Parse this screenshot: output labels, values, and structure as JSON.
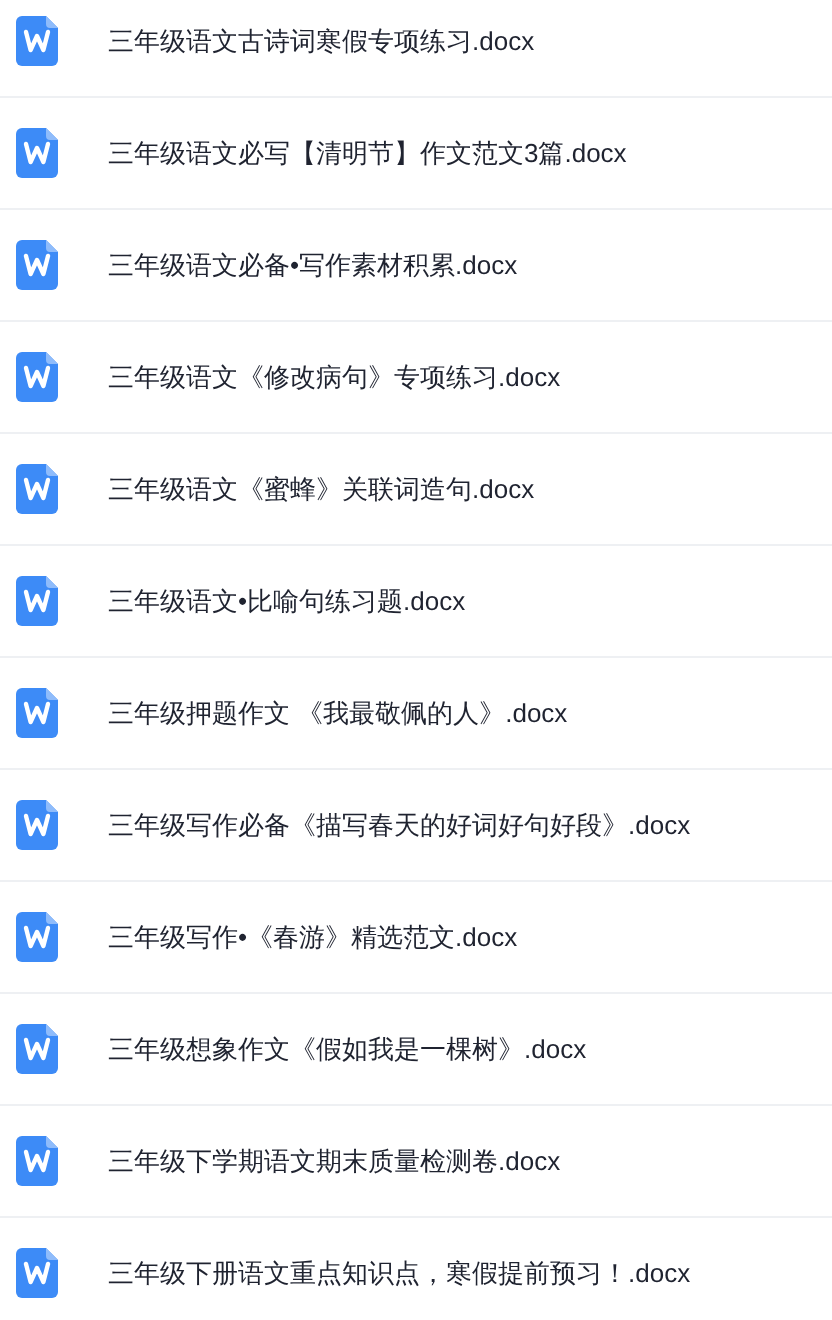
{
  "files": [
    {
      "name": "三年级语文古诗词寒假专项练习.docx",
      "kind": "word"
    },
    {
      "name": "三年级语文必写【清明节】作文范文3篇.docx",
      "kind": "word"
    },
    {
      "name": "三年级语文必备•写作素材积累.docx",
      "kind": "word"
    },
    {
      "name": "三年级语文《修改病句》专项练习.docx",
      "kind": "word"
    },
    {
      "name": "三年级语文《蜜蜂》关联词造句.docx",
      "kind": "word"
    },
    {
      "name": "三年级语文•比喻句练习题.docx",
      "kind": "word"
    },
    {
      "name": "三年级押题作文 《我最敬佩的人》.docx",
      "kind": "word"
    },
    {
      "name": "三年级写作必备《描写春天的好词好句好段》.docx",
      "kind": "word"
    },
    {
      "name": "三年级写作•《春游》精选范文.docx",
      "kind": "word"
    },
    {
      "name": "三年级想象作文《假如我是一棵树》.docx",
      "kind": "word"
    },
    {
      "name": "三年级下学期语文期末质量检测卷.docx",
      "kind": "word"
    },
    {
      "name": "三年级下册语文重点知识点，寒假提前预习！.docx",
      "kind": "word"
    }
  ]
}
